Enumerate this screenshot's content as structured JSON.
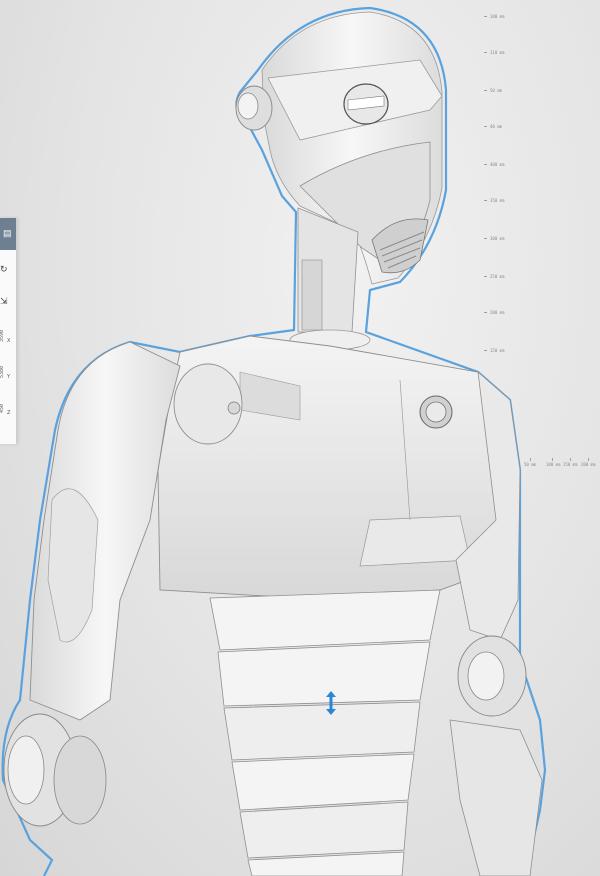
{
  "viewport": {
    "background": "#e6e6e6",
    "selection_outline_color": "#5aa2de",
    "model_fill": "#f2f2f2",
    "model_shade": "#c9c9c9"
  },
  "vertical_ruler": {
    "labels": [
      "100 mm",
      "110 mm",
      "50 mm",
      "40 mm",
      "400 mm",
      "350 mm",
      "300 mm",
      "250 mm",
      "200 mm",
      "150 mm"
    ]
  },
  "horizontal_ruler": {
    "labels": [
      "50 mm",
      "100 mm",
      "150 mm",
      "200 mm"
    ]
  },
  "side_panel": {
    "header_icon": "cube-icon",
    "icons": [
      "rotate-icon",
      "resize-icon"
    ],
    "axes": [
      {
        "axis": "X",
        "value": "3590"
      },
      {
        "axis": "Y",
        "value": "5380"
      },
      {
        "axis": "Z",
        "value": "450"
      }
    ]
  },
  "move_handle": {
    "icon": "vertical-move-arrow-icon",
    "color": "#2a86d4"
  }
}
